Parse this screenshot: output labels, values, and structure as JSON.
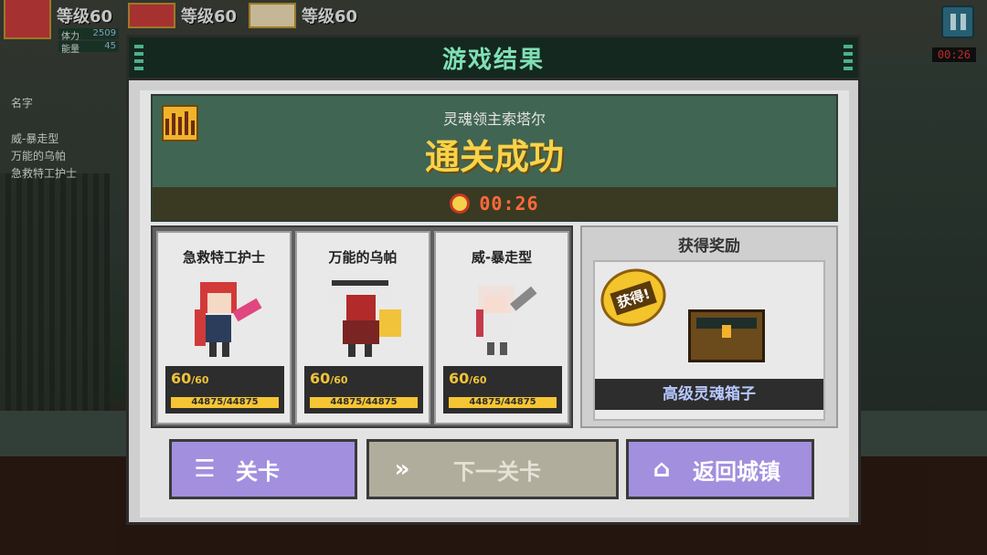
{
  "hud": {
    "heroes": [
      {
        "level": "等级60"
      },
      {
        "level": "等级60"
      },
      {
        "level": "等级60"
      }
    ],
    "stamina_label": "体力",
    "stamina_value": "2509",
    "energy_label": "能量",
    "energy_value": "45",
    "timer": "00:26",
    "side_header": "名字",
    "side_names": [
      "威-暴走型",
      "万能的乌帕",
      "急救特工护士"
    ]
  },
  "modal": {
    "title": "游戏结果",
    "boss_name": "灵魂领主索塔尔",
    "result": "通关成功",
    "clear_time": "00:26",
    "heroes": [
      {
        "name": "急救特工护士",
        "level": "60",
        "max_level": "/60",
        "hp": "44875/44875"
      },
      {
        "name": "万能的乌帕",
        "level": "60",
        "max_level": "/60",
        "hp": "44875/44875"
      },
      {
        "name": "威-暴走型",
        "level": "60",
        "max_level": "/60",
        "hp": "44875/44875"
      }
    ],
    "reward": {
      "title": "获得奖励",
      "badge": "获得!",
      "item": "高级灵魂箱子"
    },
    "buttons": {
      "stage": "关卡",
      "next": "下一关卡",
      "town": "返回城镇"
    }
  }
}
